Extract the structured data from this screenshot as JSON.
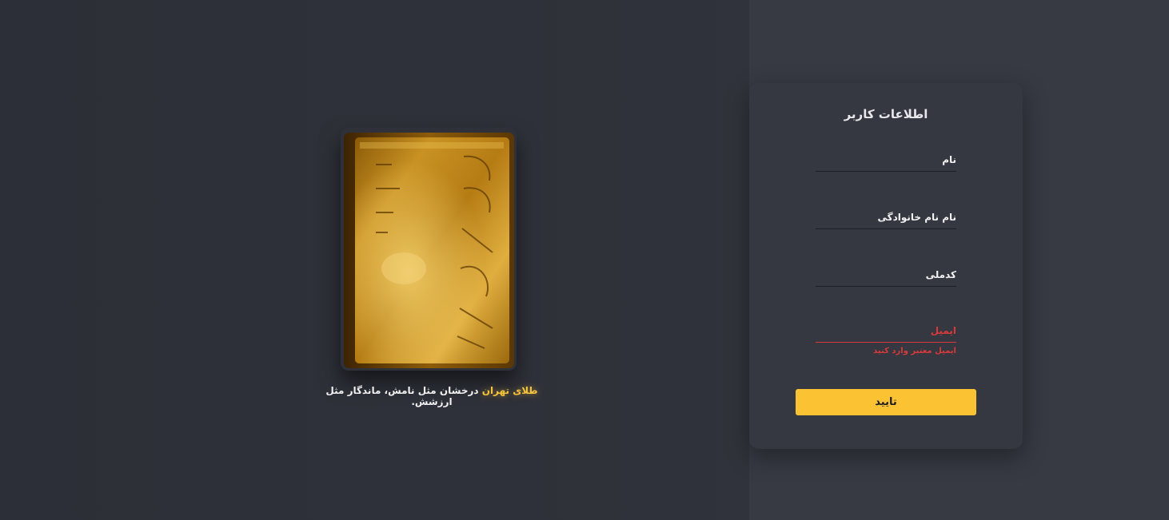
{
  "hero": {
    "bar_icon": "gold-bar-image",
    "bar_engraving": "80 2797",
    "tagline_brand": "طلای تهران",
    "tagline_rest": " درخشان مثل نامش، ماندگار مثل ارزشش."
  },
  "form": {
    "title": "اطلاعات کاربر",
    "fields": [
      {
        "label": "نام"
      },
      {
        "label": "نام نام خانوادگی"
      },
      {
        "label": "کدملی"
      },
      {
        "label": "ایمیل"
      }
    ],
    "email_error": "ایمیل معتبر وارد کنید",
    "submit_label": "تایید"
  },
  "colors": {
    "accent": "#fbc233",
    "error": "#d83a3a",
    "background": "#30323b"
  }
}
